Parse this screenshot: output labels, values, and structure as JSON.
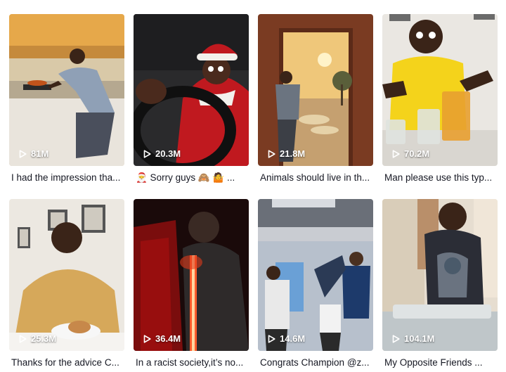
{
  "videos": [
    {
      "views": "81M",
      "caption": "I had the impression tha..."
    },
    {
      "views": "20.3M",
      "caption": "🎅 Sorry guys 🙈 🤷 ..."
    },
    {
      "views": "21.8M",
      "caption": "Animals should live in th..."
    },
    {
      "views": "70.2M",
      "caption": "Man please use this typ..."
    },
    {
      "views": "25.3M",
      "caption": "Thanks for the advice C..."
    },
    {
      "views": "36.4M",
      "caption": "In a racist society,it’s no..."
    },
    {
      "views": "14.6M",
      "caption": "Congrats Champion @z..."
    },
    {
      "views": "104.1M",
      "caption": "My Opposite Friends ..."
    }
  ],
  "icons": {
    "play": "play-outline-icon"
  }
}
